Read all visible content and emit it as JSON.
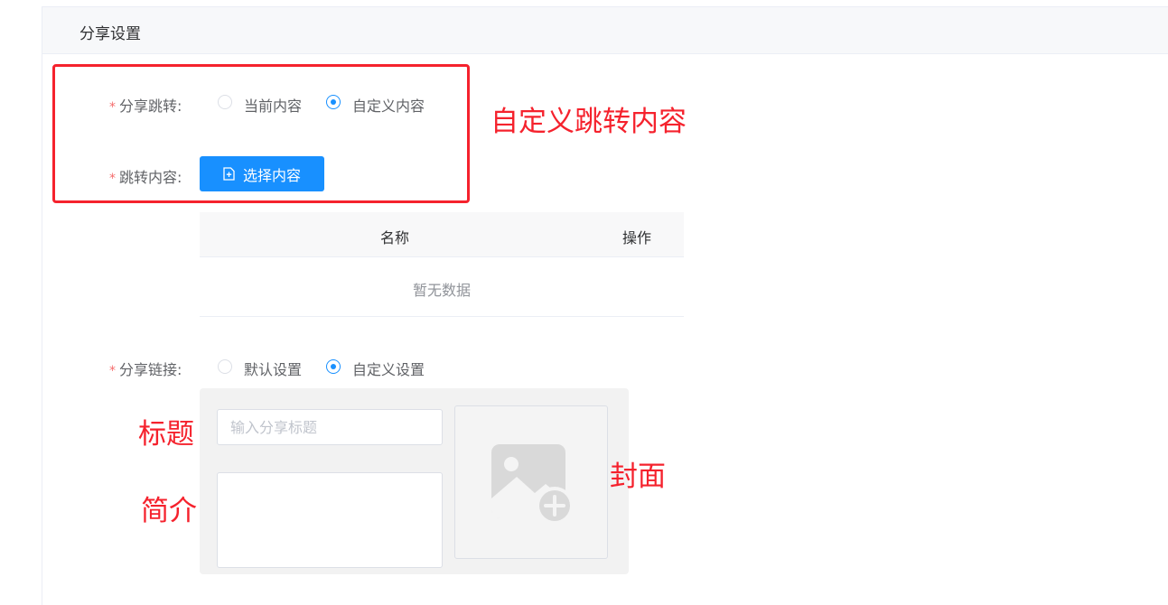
{
  "panel": {
    "title": "分享设置"
  },
  "share_jump": {
    "label": "分享跳转:",
    "required_mark": "*",
    "options": [
      {
        "label": "当前内容",
        "checked": false
      },
      {
        "label": "自定义内容",
        "checked": true
      }
    ]
  },
  "jump_content": {
    "label": "跳转内容:",
    "required_mark": "*",
    "button_label": "选择内容",
    "button_icon": "document-add-icon"
  },
  "table": {
    "columns": [
      "名称",
      "操作"
    ],
    "empty_text": "暂无数据"
  },
  "share_link": {
    "label": "分享链接:",
    "required_mark": "*",
    "options": [
      {
        "label": "默认设置",
        "checked": false
      },
      {
        "label": "自定义设置",
        "checked": true
      }
    ]
  },
  "share_card": {
    "title_placeholder": "输入分享标题",
    "title_value": "",
    "description_value": "",
    "cover_icon": "image-add-icon"
  },
  "annotations": {
    "custom_jump": "自定义跳转内容",
    "title": "标题",
    "description": "简介",
    "cover": "封面"
  },
  "colors": {
    "primary": "#1890ff",
    "annotation_red": "#f5222d",
    "required_red": "#f56c6c"
  }
}
